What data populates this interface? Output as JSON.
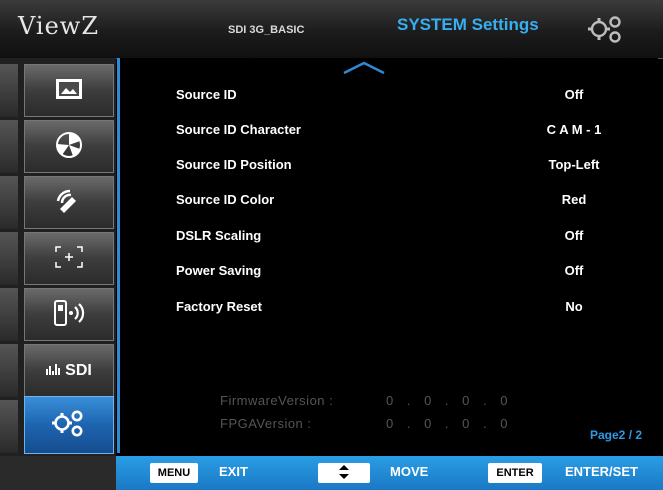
{
  "header": {
    "brand": "ViewZ",
    "model": "SDI 3G_BASIC",
    "title": "SYSTEM Settings"
  },
  "sidebar": {
    "items": [
      {
        "name": "picture",
        "icon": "picture-icon"
      },
      {
        "name": "color",
        "icon": "color-wheel-icon"
      },
      {
        "name": "audio",
        "icon": "audio-icon"
      },
      {
        "name": "marker",
        "icon": "marker-icon"
      },
      {
        "name": "remote",
        "icon": "remote-icon"
      },
      {
        "name": "sdi",
        "label": "SDI",
        "icon": "signal-bars-icon"
      },
      {
        "name": "system",
        "icon": "gear-icon",
        "active": true
      }
    ]
  },
  "settings": [
    {
      "label": "Source ID",
      "value": "Off"
    },
    {
      "label": "Source ID Character",
      "value": "C A M - 1"
    },
    {
      "label": "Source ID Position",
      "value": "Top-Left"
    },
    {
      "label": "Source ID Color",
      "value": "Red"
    },
    {
      "label": "DSLR Scaling",
      "value": "Off"
    },
    {
      "label": "Power Saving",
      "value": "Off"
    },
    {
      "label": "Factory Reset",
      "value": "No"
    }
  ],
  "firmware": {
    "firmware_label": "FirmwareVersion :",
    "firmware_value": "0 . 0 . 0 . 0",
    "fpga_label": "FPGAVersion :",
    "fpga_value": "0 . 0 . 0 . 0"
  },
  "page_indicator": "Page2 / 2",
  "footer": {
    "menu_key": "MENU",
    "menu_action": "EXIT",
    "move_action": "MOVE",
    "enter_key": "ENTER",
    "enter_action": "ENTER/SET"
  },
  "colors": {
    "accent": "#2c8ad6",
    "title": "#37aef0",
    "footer": "#1f86d2"
  }
}
